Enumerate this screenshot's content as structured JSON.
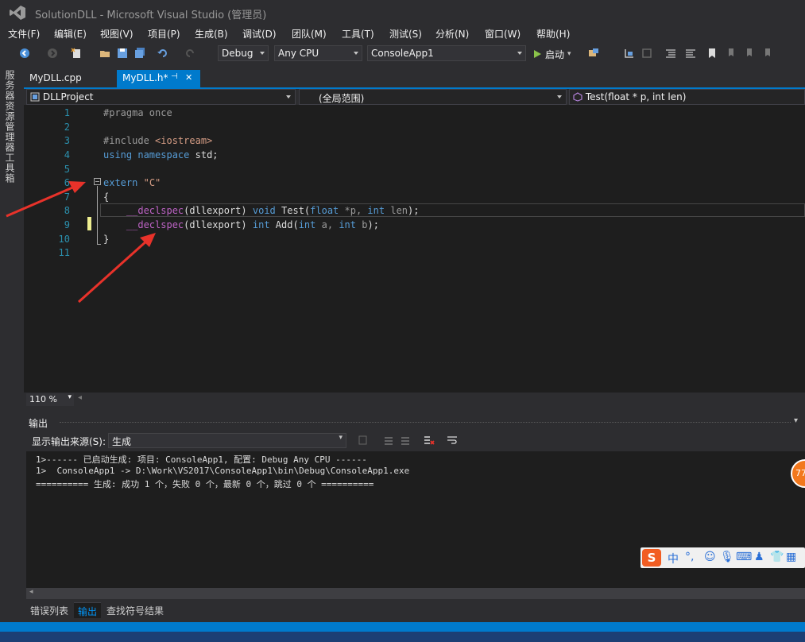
{
  "window": {
    "title": "SolutionDLL - Microsoft Visual Studio (管理员)"
  },
  "menu": [
    "文件(F)",
    "编辑(E)",
    "视图(V)",
    "项目(P)",
    "生成(B)",
    "调试(D)",
    "团队(M)",
    "工具(T)",
    "测试(S)",
    "分析(N)",
    "窗口(W)",
    "帮助(H)"
  ],
  "toolbar": {
    "config": "Debug",
    "platform": "Any CPU",
    "project": "ConsoleApp1",
    "start_label": "启动"
  },
  "side_tabs": [
    "服务器资源管理器",
    "工具箱"
  ],
  "tabs": [
    {
      "label": "MyDLL.cpp",
      "active": false
    },
    {
      "label": "MyDLL.h*",
      "active": true,
      "pin": "⊣",
      "close": "✕"
    }
  ],
  "nav": {
    "project": "DLLProject",
    "scope": "(全局范围)",
    "member": "Test(float * p, int len)"
  },
  "editor": {
    "line_numbers": [
      "1",
      "2",
      "3",
      "4",
      "5",
      "6",
      "7",
      "8",
      "9",
      "10",
      "11"
    ],
    "line1": "#pragma once",
    "line3_directive": "#include",
    "line3_header": "<iostream>",
    "line4_kw1": "using",
    "line4_kw2": "namespace",
    "line4_name": "std;",
    "line6_kw": "extern",
    "line6_str": "\"C\"",
    "line7": "{",
    "line8_macro": "__declspec",
    "line8_arg": "(dllexport)",
    "line8_ret": "void",
    "line8_fn": "Test(",
    "line8_t1": "float",
    "line8_p1": "*p,",
    "line8_t2": "int",
    "line8_p2": "len",
    "line8_end": ");",
    "line9_macro": "__declspec",
    "line9_arg": "(dllexport)",
    "line9_ret": "int",
    "line9_fn": "Add(",
    "line9_t1": "int",
    "line9_p1": "a,",
    "line9_t2": "int",
    "line9_p2": "b",
    "line9_end": ");",
    "line10": "}",
    "zoom": "110 %"
  },
  "output": {
    "title": "输出",
    "source_label": "显示输出来源(S):",
    "source_value": "生成",
    "lines": [
      "1>------ 已启动生成: 项目: ConsoleApp1, 配置: Debug Any CPU ------",
      "1>  ConsoleApp1 -> D:\\Work\\VS2017\\ConsoleApp1\\bin\\Debug\\ConsoleApp1.exe",
      "========== 生成: 成功 1 个，失败 0 个，最新 0 个，跳过 0 个 =========="
    ]
  },
  "bottom_tabs": [
    "错误列表",
    "输出",
    "查找符号结果"
  ],
  "ime": {
    "logo": "S",
    "mode": "中",
    "punct": "°,"
  },
  "badge": "77",
  "colors": {
    "accent": "#007acc",
    "editor_bg": "#1e1e1e",
    "chrome_bg": "#2d2d30",
    "keyword": "#569cd6",
    "string": "#d69d85",
    "arrow": "#e8322a"
  }
}
